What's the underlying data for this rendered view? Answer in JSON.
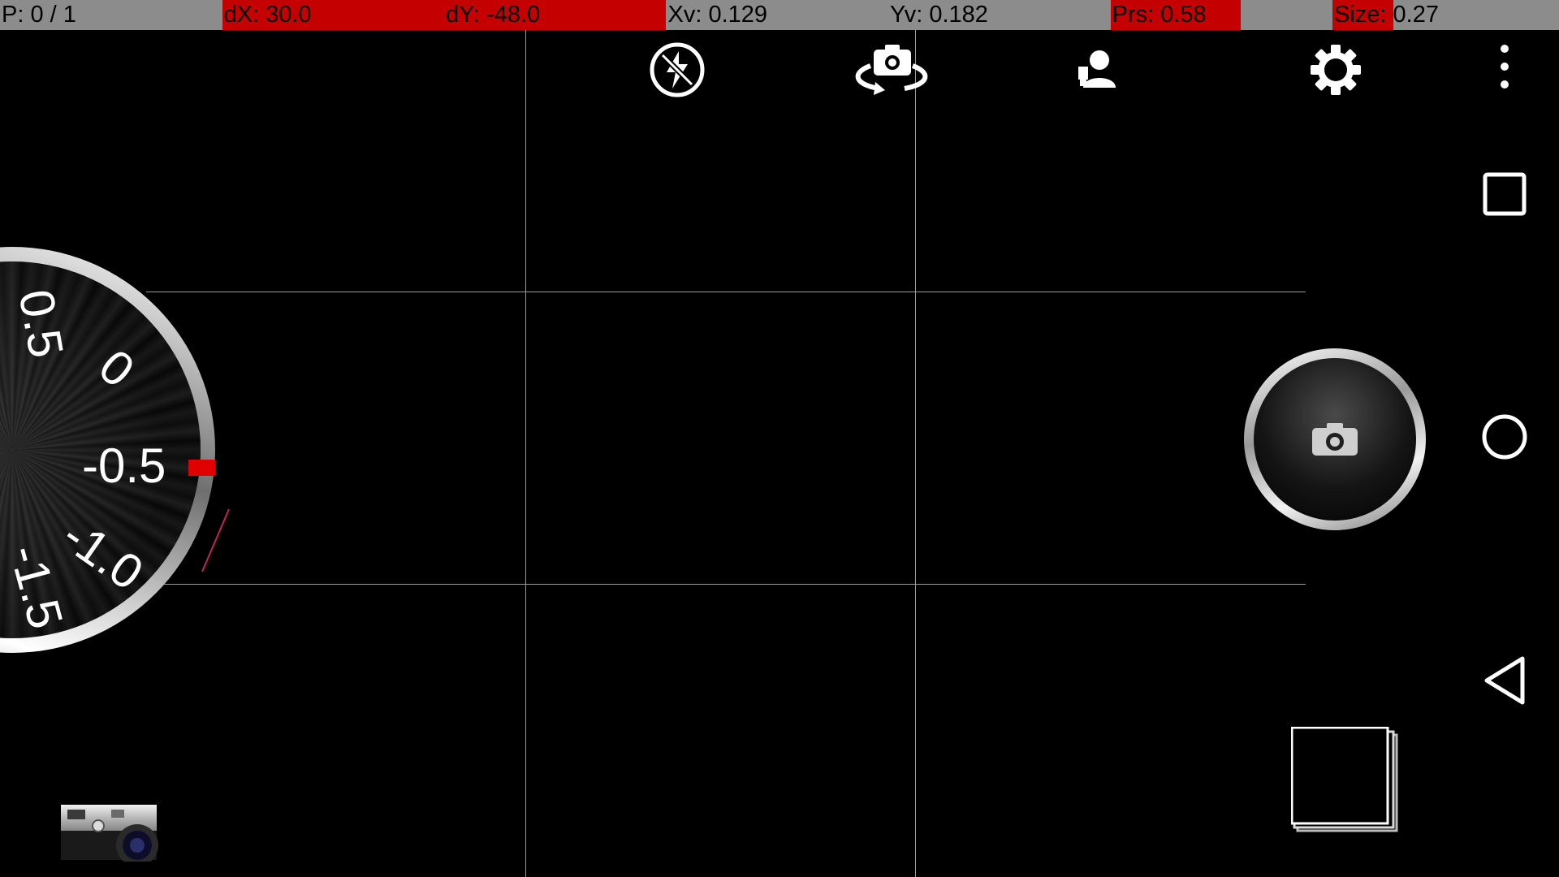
{
  "debug_bar": {
    "pointer_count": "P: 0 / 1",
    "dx": "dX: 30.0",
    "dy": "dY: -48.0",
    "xv": "Xv: 0.129",
    "yv": "Yv: 0.182",
    "pressure": "Prs: 0.58",
    "size": "Size: 0.27",
    "highlight_color": "#c40000"
  },
  "toolbar": {
    "flash_icon": "flash-off-icon",
    "switch_camera_icon": "switch-camera-icon",
    "scene_mode_icon": "portrait-mode-icon",
    "settings_icon": "gear-icon"
  },
  "ev_dial": {
    "labels": [
      "0.5",
      "0",
      "-0.5",
      "-1.0",
      "-1.5"
    ],
    "selected_value": "-0.5",
    "marker_color": "#e00000"
  },
  "shutter_icon": "camera-icon",
  "navigation": {
    "menu_icon": "more-vert-icon",
    "recents_icon": "recents-square-icon",
    "home_icon": "home-circle-icon",
    "back_icon": "back-triangle-icon"
  }
}
